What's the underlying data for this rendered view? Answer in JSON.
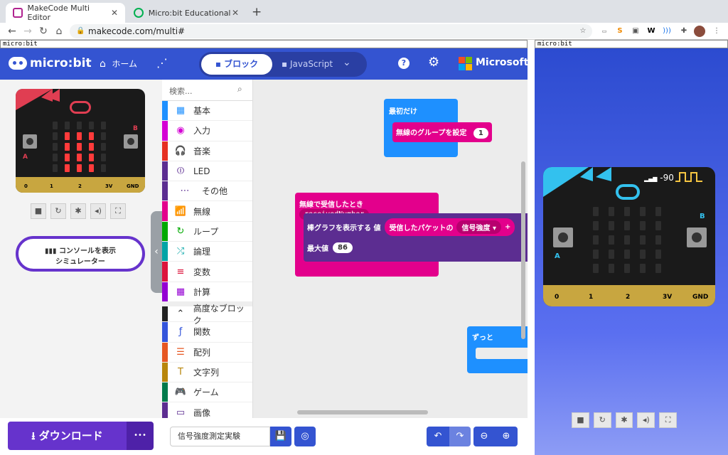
{
  "browser": {
    "tabs": [
      {
        "label": "MakeCode Multi Editor",
        "close": "✕"
      },
      {
        "label": "Micro:bit Educational Foundatio",
        "close": "✕"
      }
    ],
    "new_tab": "+",
    "url": "makecode.com/multi#"
  },
  "frames": {
    "left_label": "micro:bit",
    "right_label": "micro:bit"
  },
  "header": {
    "logo": "micro:bit",
    "home": "ホーム",
    "blocks_tab": "ブロック",
    "js_tab": "JavaScript",
    "brand": "Microsoft"
  },
  "simulator": {
    "pins": [
      "0",
      "1",
      "2",
      "3V",
      "GND"
    ],
    "btn_a": "A",
    "btn_b": "B",
    "console_btn": "コンソールを表示",
    "console_sub": "シミュレーター"
  },
  "toolbox": {
    "search_placeholder": "検索...",
    "categories": [
      {
        "label": "基本",
        "color": "#1e90ff",
        "icon": "▦"
      },
      {
        "label": "入力",
        "color": "#d400d4",
        "icon": "◉"
      },
      {
        "label": "音楽",
        "color": "#e63022",
        "icon": "🎧"
      },
      {
        "label": "LED",
        "color": "#5c2d91",
        "icon": "⏼"
      },
      {
        "label": "その他",
        "color": "#5c2d91",
        "icon": "⋯"
      },
      {
        "label": "無線",
        "color": "#e3008c",
        "icon": "📶"
      },
      {
        "label": "ループ",
        "color": "#00aa00",
        "icon": "↻"
      },
      {
        "label": "論理",
        "color": "#00a4a6",
        "icon": "⤮"
      },
      {
        "label": "変数",
        "color": "#dc143c",
        "icon": "≡"
      },
      {
        "label": "計算",
        "color": "#9400d3",
        "icon": "▦"
      },
      {
        "label": "高度なブロック",
        "color": "#222222",
        "icon": "⌃"
      },
      {
        "label": "関数",
        "color": "#3455db",
        "icon": "ƒ"
      },
      {
        "label": "配列",
        "color": "#e65722",
        "icon": "☰"
      },
      {
        "label": "文字列",
        "color": "#b8860b",
        "icon": "T"
      },
      {
        "label": "ゲーム",
        "color": "#007a4b",
        "icon": "🎮"
      },
      {
        "label": "画像",
        "color": "#5c2d91",
        "icon": "▭"
      }
    ]
  },
  "blocks": {
    "on_start": "最初だけ",
    "set_group": "無線のグループを設定",
    "group_value": "1",
    "on_received": "無線で受信したとき",
    "received_var": "receivedNumber",
    "plot_bar": "棒グラフを表示する 値",
    "packet": "受信したパケットの",
    "signal": "信号強度 ▾",
    "max_label": "最大値",
    "max_value": "86",
    "forever": "ずっと"
  },
  "bottom": {
    "download": "ダウンロード",
    "more": "•••",
    "project_name": "信号強度測定実験"
  },
  "right_sim": {
    "signal_value": "-90",
    "pins": [
      "0",
      "1",
      "2",
      "3V",
      "GND"
    ],
    "btn_a": "A",
    "btn_b": "B"
  }
}
